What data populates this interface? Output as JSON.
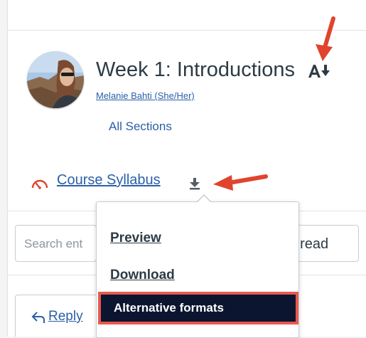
{
  "topic": {
    "title": "Week 1: Introductions",
    "author": "Melanie Bahti (She/Her)",
    "sections": "All Sections"
  },
  "attachment": {
    "name": "Course Syllabus"
  },
  "menu": {
    "items": [
      {
        "label": "Preview"
      },
      {
        "label": "Download"
      },
      {
        "label": "Alternative formats"
      }
    ]
  },
  "toolbar": {
    "search_placeholder": "Search ent",
    "unread_label": "nread"
  },
  "reply": {
    "label": "Reply"
  },
  "colors": {
    "link": "#2a5fa8",
    "text": "#2d3b45",
    "highlight": "#e85a4f",
    "menu_active_bg": "#0c1530"
  },
  "icons": [
    "accessibility-download-icon",
    "gauge-icon",
    "download-icon",
    "reply-icon",
    "annotation-arrow-icon"
  ]
}
